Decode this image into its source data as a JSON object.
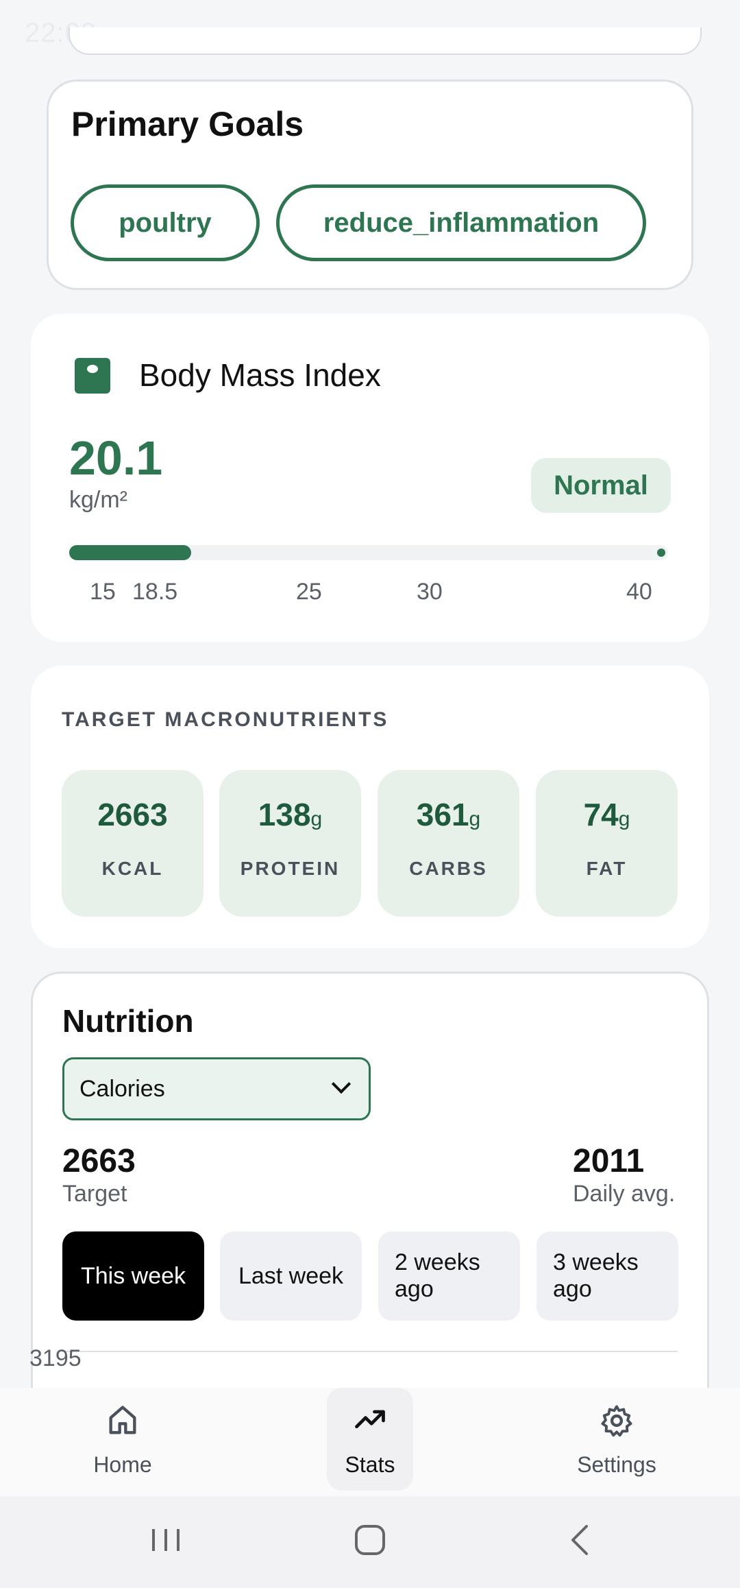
{
  "status_bar": {
    "time": "22:03",
    "right": ""
  },
  "goals": {
    "title": "Primary Goals",
    "chips": [
      "poultry",
      "reduce_inflammation"
    ]
  },
  "bmi": {
    "title": "Body Mass Index",
    "value": "20.1",
    "unit": "kg/m²",
    "category": "Normal",
    "scale": {
      "min": 15,
      "max": 40,
      "current": 20.1
    },
    "ticks": [
      "15",
      "18.5",
      "25",
      "30",
      "40"
    ],
    "accent": "#2e7552"
  },
  "macros": {
    "title": "TARGET MACRONUTRIENTS",
    "items": [
      {
        "value": "2663",
        "unit": "",
        "label": "KCAL"
      },
      {
        "value": "138",
        "unit": "g",
        "label": "PROTEIN"
      },
      {
        "value": "361",
        "unit": "g",
        "label": "CARBS"
      },
      {
        "value": "74",
        "unit": "g",
        "label": "FAT"
      }
    ]
  },
  "nutrition": {
    "title": "Nutrition",
    "metric_select": "Calories",
    "target_value": "2663",
    "target_label": "Target",
    "avg_value": "2011",
    "avg_label": "Daily avg.",
    "week_tabs": [
      "This week",
      "Last week",
      "2 weeks ago",
      "3 weeks ago"
    ],
    "chart_top_label": "3195"
  },
  "bottom_nav": {
    "items": [
      "Home",
      "Stats",
      "Settings"
    ],
    "active": "Stats"
  }
}
